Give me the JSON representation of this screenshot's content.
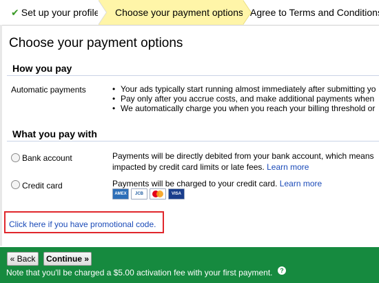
{
  "steps": [
    {
      "label": "Set up your profile",
      "done_icon": "check-icon"
    },
    {
      "label": "Choose your payment options"
    },
    {
      "label": "Agree to Terms and Conditions"
    }
  ],
  "page_title": "Choose your payment options",
  "how_you_pay": {
    "header": "How you pay",
    "label": "Automatic payments",
    "bullets": [
      "Your ads typically start running almost immediately after submitting yo",
      "Pay only after you accrue costs, and make additional payments when",
      "We automatically charge you when you reach your billing threshold or"
    ]
  },
  "what_you_pay_with": {
    "header": "What you pay with",
    "bank": {
      "label": "Bank account",
      "desc_line1": "Payments will be directly debited from your bank account, which means",
      "desc_line2": "impacted by credit card limits or late fees.",
      "link": "Learn more"
    },
    "credit_card": {
      "label": "Credit card",
      "desc": "Payments will be charged to your credit card.",
      "link": "Learn more",
      "card_logos": [
        "AMEX",
        "JCB",
        "MasterCard",
        "VISA"
      ]
    }
  },
  "promo": {
    "link": "Click here if you have promotional code."
  },
  "footer": {
    "back_label": "« Back",
    "continue_label": "Continue »",
    "note": "Note that you'll be charged a $5.00 activation fee with your first payment.",
    "help_icon": "?"
  },
  "colors": {
    "accent_green": "#168a3f",
    "step_highlight": "#fff5a8",
    "link": "#1a4ab8",
    "promo_border": "#e0262b"
  }
}
